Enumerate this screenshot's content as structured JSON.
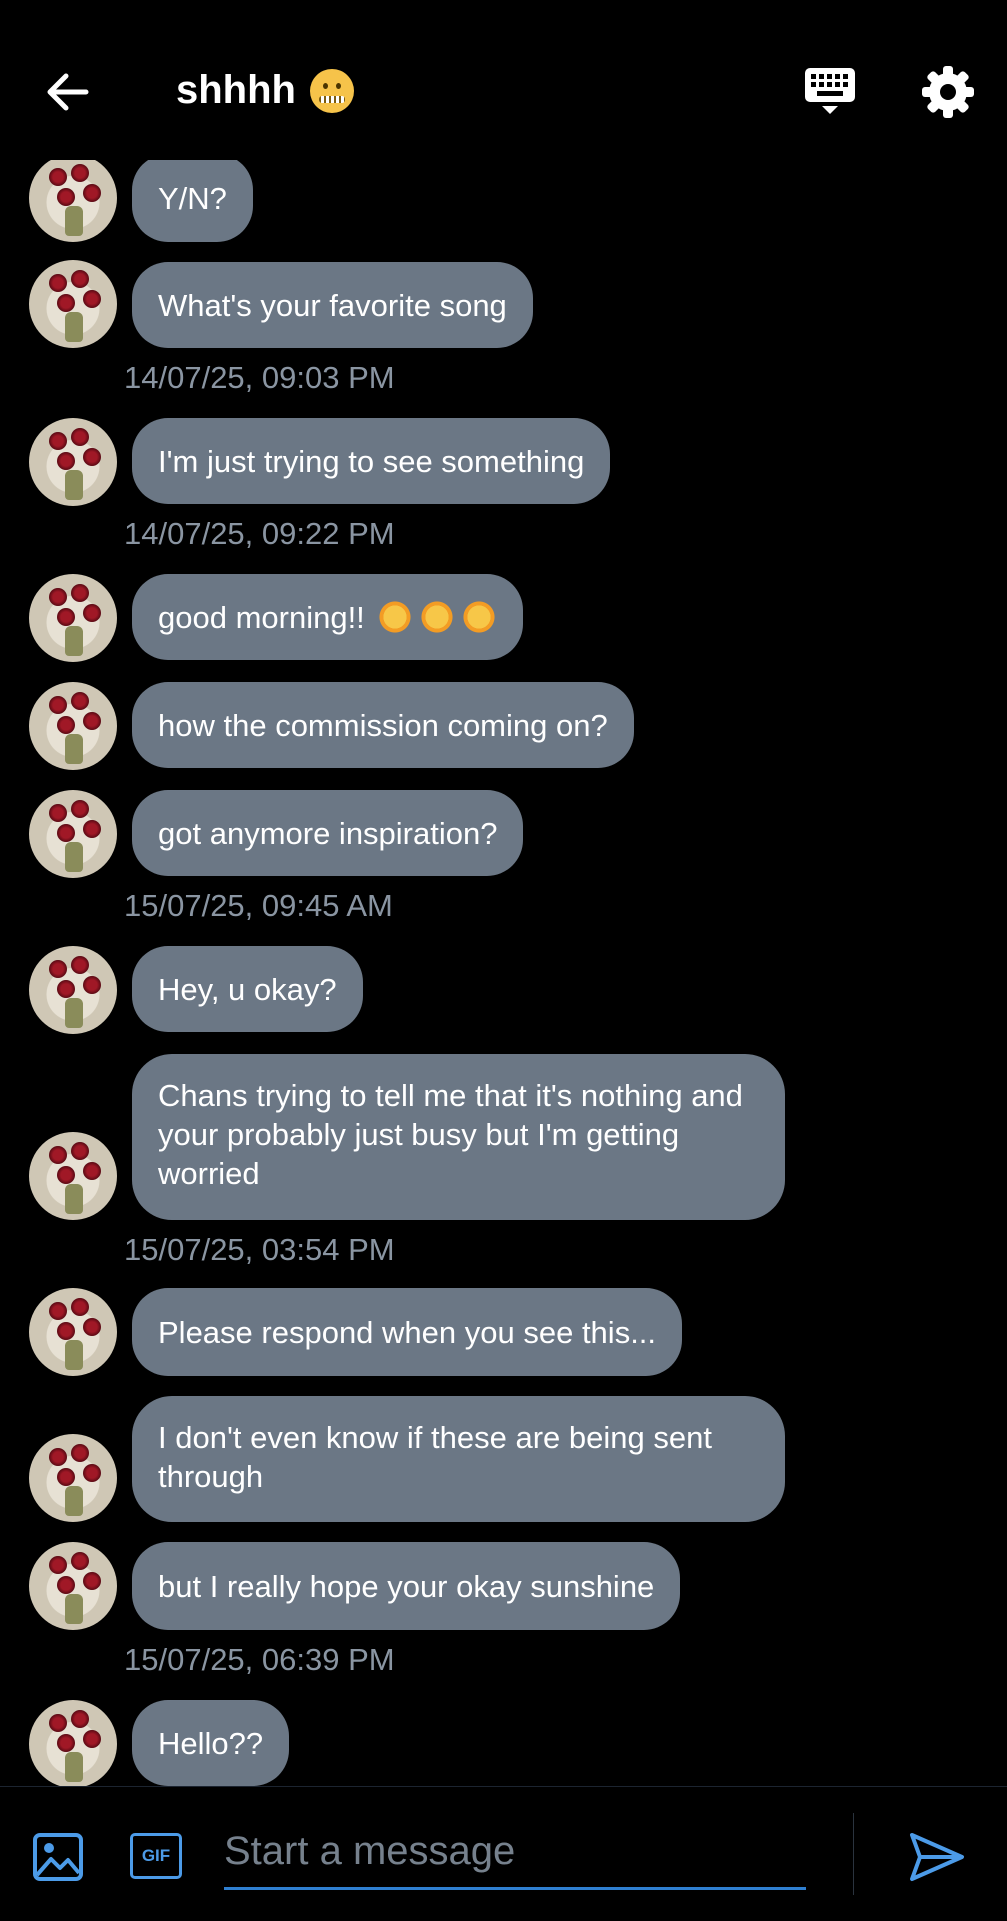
{
  "header": {
    "title": "shhhh",
    "title_emoji": "zipper-mouth-face",
    "back_icon": "arrow-left-icon",
    "keyboard_icon": "keyboard-icon",
    "settings_icon": "gear-icon"
  },
  "messages": [
    {
      "text": "Y/N?"
    },
    {
      "text": "What's your favorite song"
    },
    {
      "timestamp": "14/07/25, 09:03 PM"
    },
    {
      "text": "I'm just trying to see something"
    },
    {
      "timestamp": "14/07/25, 09:22 PM"
    },
    {
      "text": "good morning!!"
    },
    {
      "text": "how the commission coming on?"
    },
    {
      "text": "got anymore inspiration?"
    },
    {
      "timestamp": "15/07/25, 09:45 AM"
    },
    {
      "text": "Hey, u okay?"
    },
    {
      "text": "Chans trying to tell me that it's nothing and your probably just busy but I'm getting worried"
    },
    {
      "timestamp": "15/07/25, 03:54 PM"
    },
    {
      "text": "Please respond when you see this..."
    },
    {
      "text": "I don't even know if these are being sent through"
    },
    {
      "text": "but I really hope your okay sunshine"
    },
    {
      "timestamp": "15/07/25, 06:39 PM"
    },
    {
      "text": "Hello??"
    }
  ],
  "composer": {
    "placeholder": "Start a message",
    "gif_label": "GIF"
  },
  "colors": {
    "bubble": "#6b7785",
    "accent": "#4c9be8",
    "timestamp": "#8a95a2"
  }
}
